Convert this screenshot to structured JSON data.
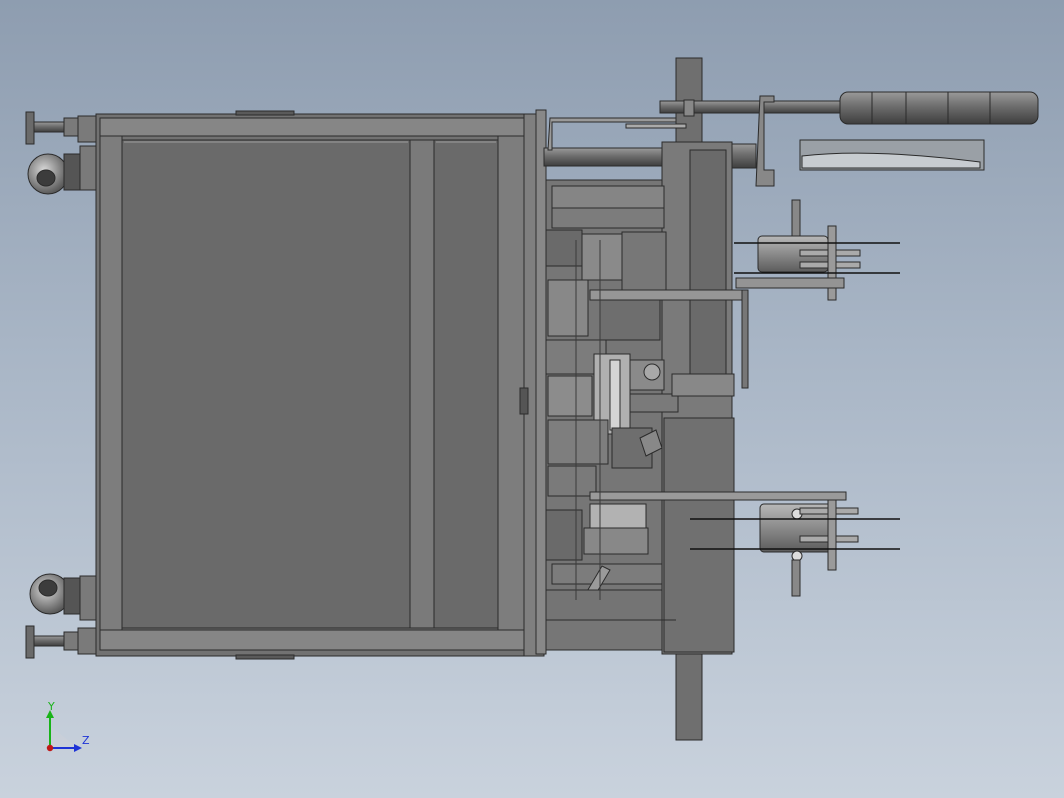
{
  "viewport": {
    "background_top": "#8e9db0",
    "background_bottom": "#c9d2dd"
  },
  "model": {
    "description_icon": "cad-assembly",
    "body_color": "#7a7a7a",
    "edge_color": "#2b2b2b",
    "panel_color": "#6c6c6c"
  },
  "triad": {
    "y_label": "Y",
    "z_label": "Z",
    "y_color": "#19b319",
    "z_color": "#1d33d6",
    "origin_color": "#c01818"
  }
}
